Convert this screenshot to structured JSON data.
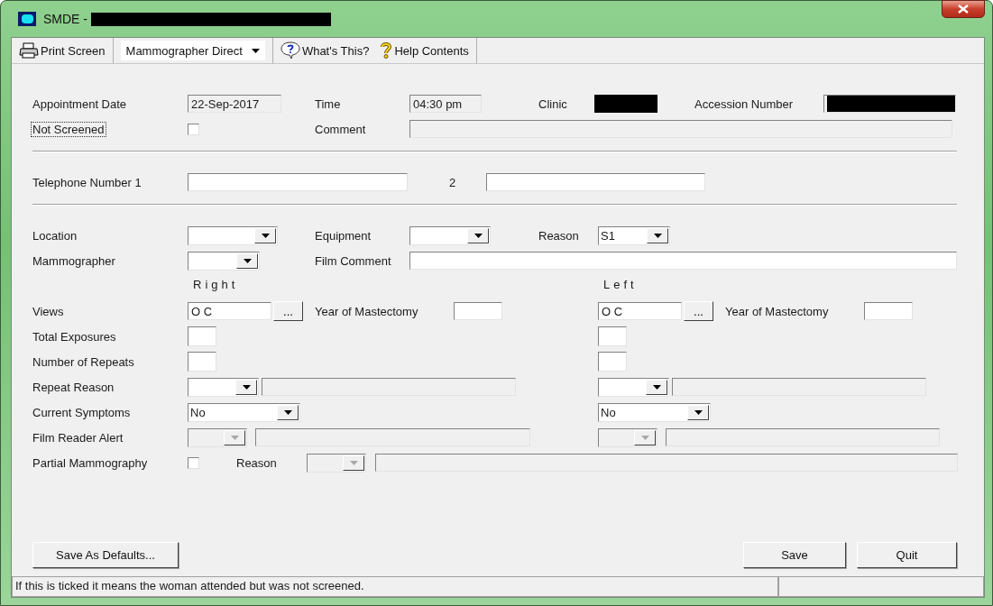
{
  "window": {
    "title": "SMDE - ",
    "title_redacted": true
  },
  "toolbar": [
    {
      "kind": "print",
      "label": "Print Screen"
    },
    {
      "kind": "dropdown",
      "label": "Mammographer Direct"
    },
    {
      "kind": "whats-this",
      "label": "What's This?"
    },
    {
      "kind": "help",
      "label": "Help Contents"
    }
  ],
  "appointment": {
    "date_label": "Appointment Date",
    "date": "22-Sep-2017",
    "time_label": "Time",
    "time": "04:30 pm",
    "clinic_label": "Clinic",
    "clinic_redacted": true,
    "accession_label": "Accession Number",
    "accession_redacted": true
  },
  "not_screened": {
    "label": "Not Screened",
    "checked": false,
    "focused": true
  },
  "comment": {
    "label": "Comment",
    "disabled": true
  },
  "telephone": {
    "label": "Telephone Number 1",
    "label_2": "2"
  },
  "location": {
    "label": "Location"
  },
  "equipment": {
    "label": "Equipment"
  },
  "reason": {
    "label": "Reason",
    "value": "S1"
  },
  "mammographer": {
    "label": "Mammographer"
  },
  "film_comment": {
    "label": "Film Comment",
    "disabled": false
  },
  "sides": [
    {
      "heading": "Right"
    },
    {
      "heading": "Left"
    }
  ],
  "side_rows": [
    {
      "kind": "views",
      "label": "Views",
      "cells": [
        {
          "value": "O C",
          "button": "...",
          "year_label": "Year of Mastectomy"
        },
        {
          "value": "O C",
          "button": "...",
          "year_label": "Year of Mastectomy"
        }
      ]
    },
    {
      "kind": "box",
      "label": "Total Exposures"
    },
    {
      "kind": "box",
      "label": "Number of Repeats"
    },
    {
      "kind": "combo-note",
      "label": "Repeat Reason",
      "disabled": false
    },
    {
      "kind": "combo",
      "label": "Current Symptoms",
      "cells": [
        {
          "value": "No"
        },
        {
          "value": "No"
        }
      ]
    },
    {
      "kind": "combo-note",
      "label": "Film Reader Alert",
      "disabled": true
    }
  ],
  "partial": {
    "label": "Partial Mammography",
    "checked": false,
    "reason_label": "Reason",
    "reason_disabled": true
  },
  "buttons": {
    "defaults": "Save As Defaults...",
    "save": "Save",
    "quit": "Quit"
  },
  "status_bar": {
    "message": "If this is ticked it means the woman attended but was not screened."
  }
}
